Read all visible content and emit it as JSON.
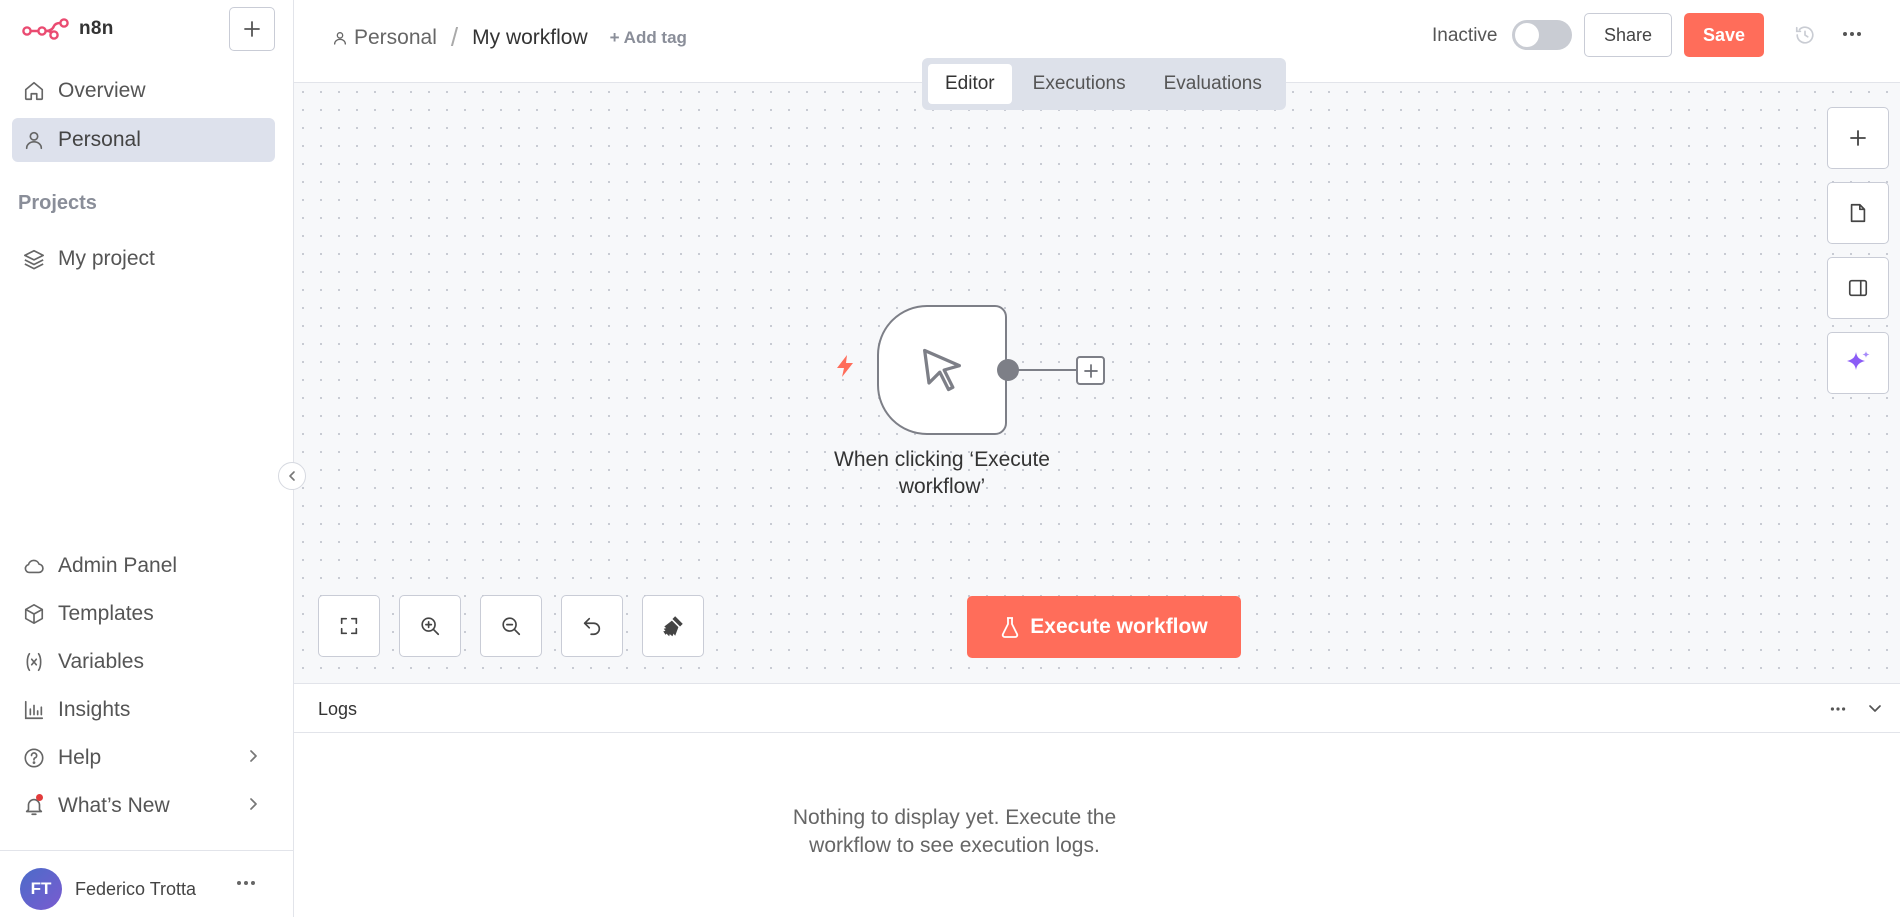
{
  "app": {
    "name": "n8n"
  },
  "sidebar": {
    "top_items": [
      {
        "label": "Overview",
        "icon": "home-icon"
      },
      {
        "label": "Personal",
        "icon": "user-icon",
        "active": true
      }
    ],
    "projects_title": "Projects",
    "projects": [
      {
        "label": "My project",
        "icon": "layers-icon"
      }
    ],
    "bottom_items": [
      {
        "label": "Admin Panel",
        "icon": "cloud-icon"
      },
      {
        "label": "Templates",
        "icon": "box-icon"
      },
      {
        "label": "Variables",
        "icon": "variable-icon"
      },
      {
        "label": "Insights",
        "icon": "bar-chart-icon"
      },
      {
        "label": "Help",
        "icon": "help-icon",
        "has_submenu": true
      },
      {
        "label": "What’s New",
        "icon": "bell-icon",
        "has_submenu": true,
        "has_notification": true
      }
    ],
    "user": {
      "initials": "FT",
      "name": "Federico Trotta"
    }
  },
  "header": {
    "breadcrumb_project": "Personal",
    "breadcrumb_separator": "/",
    "workflow_name": "My workflow",
    "add_tag_label": "+ Add tag",
    "status_label": "Inactive",
    "active": false,
    "share_label": "Share",
    "save_label": "Save"
  },
  "tabs": [
    {
      "label": "Editor",
      "active": true
    },
    {
      "label": "Executions",
      "active": false
    },
    {
      "label": "Evaluations",
      "active": false
    }
  ],
  "canvas": {
    "node": {
      "label_line1": "When clicking ‘Execute",
      "label_line2": "workflow’",
      "icon": "cursor-icon",
      "trigger_icon": "bolt-icon"
    },
    "execute_label": "Execute workflow"
  },
  "logs": {
    "title": "Logs",
    "empty_line1": "Nothing to display yet. Execute the",
    "empty_line2": "workflow to see execution logs."
  },
  "colors": {
    "accent": "#ff6d5a",
    "active_nav_bg": "#dde1ec",
    "ai_sparkle": "#8b5cf6",
    "notification": "#e23b3b"
  }
}
